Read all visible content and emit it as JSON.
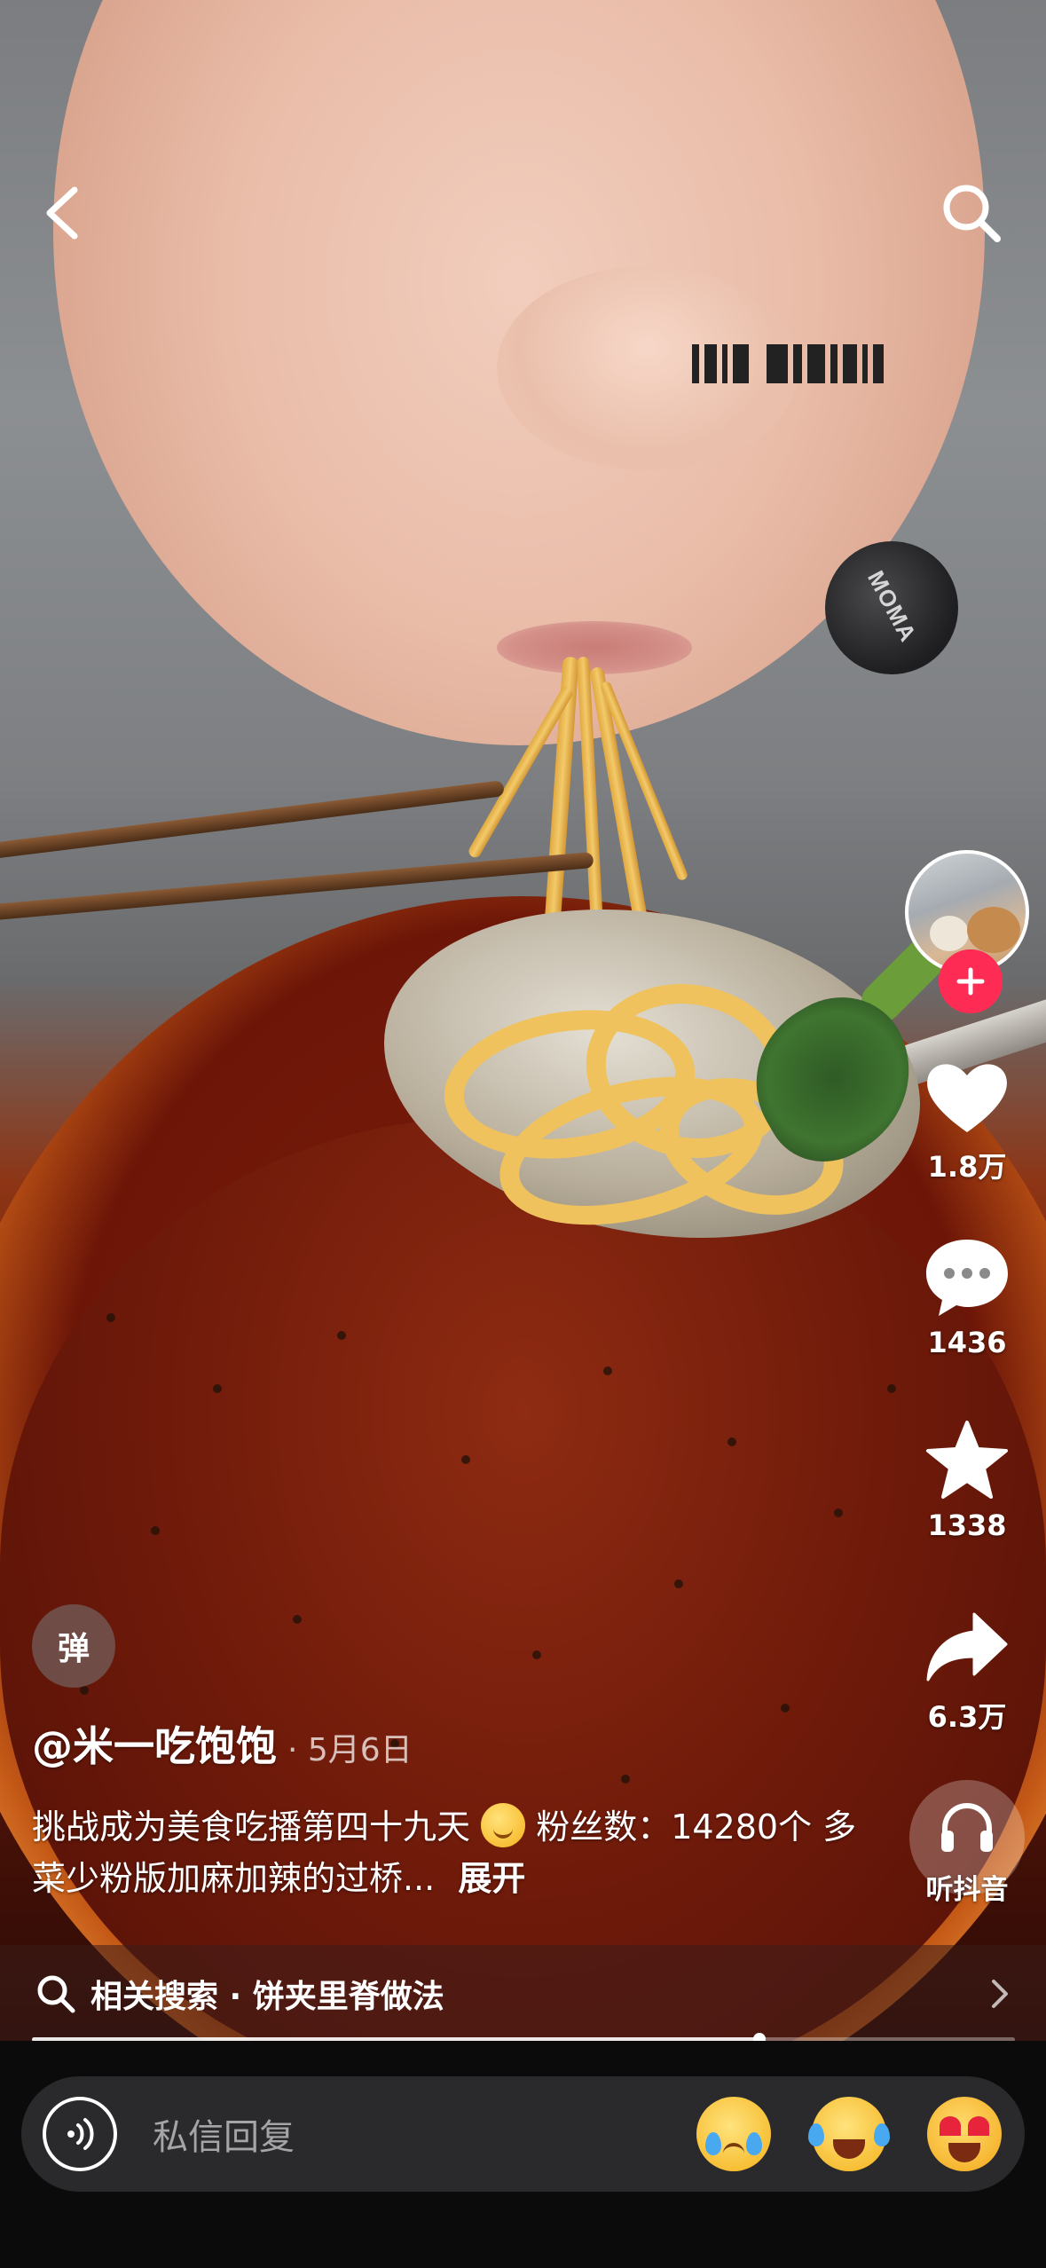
{
  "header": {
    "back_icon": "chevron-left-icon",
    "search_icon": "search-icon"
  },
  "rail": {
    "avatar_icon": "avatar-cat-icon",
    "follow_icon": "plus-icon",
    "like": {
      "icon": "heart-icon",
      "count": "1.8万"
    },
    "comment": {
      "icon": "comment-bubble-icon",
      "count": "1436"
    },
    "favorite": {
      "icon": "star-icon",
      "count": "1338"
    },
    "share": {
      "icon": "share-arrow-icon",
      "count": "6.3万"
    },
    "listen": {
      "icon": "headphones-icon",
      "label": "听抖音"
    }
  },
  "video": {
    "danmaku_label": "弹",
    "author": "@米一吃饱饱",
    "date": "· 5月6日",
    "caption_part1": "挑战成为美食吃播第四十九天",
    "caption_part2": " 粉丝数：14280个 多菜少粉版加麻加辣的过桥...",
    "expand_label": "展开",
    "mic_brand": "MOMA"
  },
  "related_search": {
    "icon": "search-icon",
    "text": "相关搜索 · 饼夹里脊做法",
    "chevron_icon": "chevron-right-icon"
  },
  "playback": {
    "progress": 0.74
  },
  "reply_bar": {
    "voice_icon": "voice-wave-icon",
    "placeholder": "私信回复",
    "emojis": [
      "crying-face-icon",
      "laugh-cry-face-icon",
      "heart-eyes-face-icon"
    ]
  },
  "colors": {
    "accent": "#fe2c55",
    "bottom_bar": "#0b0b0b",
    "reply_box": "#2a2a2c"
  }
}
